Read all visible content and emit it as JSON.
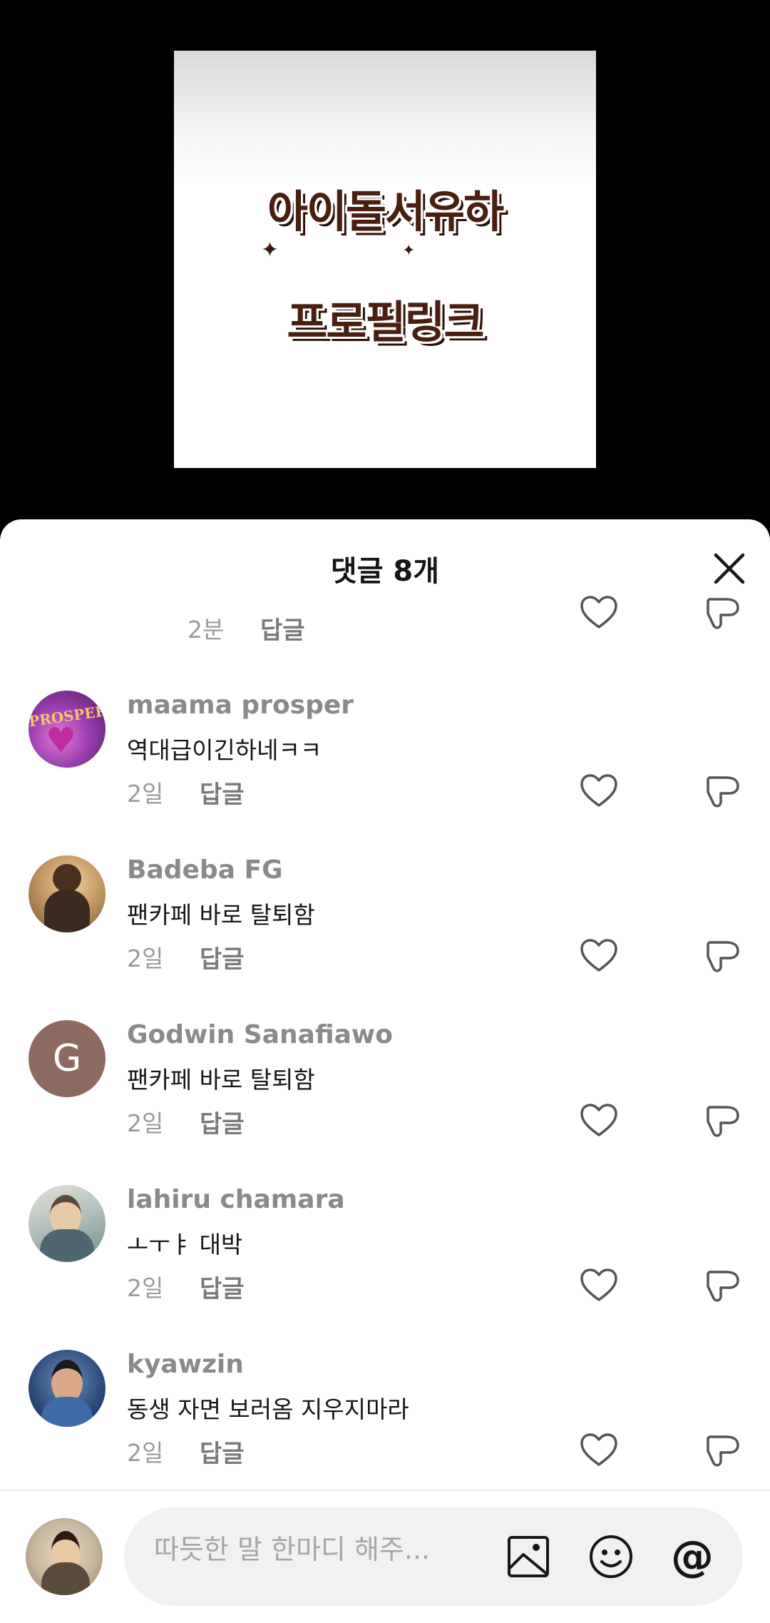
{
  "video": {
    "thumbnail_line1": "아이돌서유하",
    "thumbnail_line2": "프로필링크"
  },
  "sheet": {
    "title": "댓글 8개",
    "close_icon": "close-icon"
  },
  "partial_comment": {
    "time": "2분",
    "reply_label": "답글"
  },
  "comments": [
    {
      "username": "maama prosper",
      "text": "역대급이긴하네ㅋㅋ",
      "time": "2일",
      "reply_label": "답글",
      "avatar_color": "#7b2d8e"
    },
    {
      "username": "Badeba FG",
      "text": "팬카페 바로 탈퇴함",
      "time": "2일",
      "reply_label": "답글",
      "avatar_color": "#b98b5a"
    },
    {
      "username": "Godwin Sanafiawo",
      "text": "팬카페 바로 탈퇴함",
      "time": "2일",
      "reply_label": "답글",
      "avatar_color": "#8d6a60",
      "avatar_letter": "G"
    },
    {
      "username": "lahiru chamara",
      "text": "ㅗㅜㅑ 대박",
      "time": "2일",
      "reply_label": "답글",
      "avatar_color": "#6f8c8a"
    },
    {
      "username": "kyawzin",
      "text": "동생 자면 보러옴 지우지마라",
      "time": "2일",
      "reply_label": "답글",
      "avatar_color": "#3a5a8a"
    }
  ],
  "composer": {
    "placeholder": "따듯한 말 한마디 해주...",
    "icons": [
      "image-icon",
      "emoji-icon",
      "mention-icon"
    ],
    "mention_symbol": "@"
  },
  "colors": {
    "like": "#555555",
    "username": "#8a8a8a",
    "time": "#9a9a9a"
  }
}
